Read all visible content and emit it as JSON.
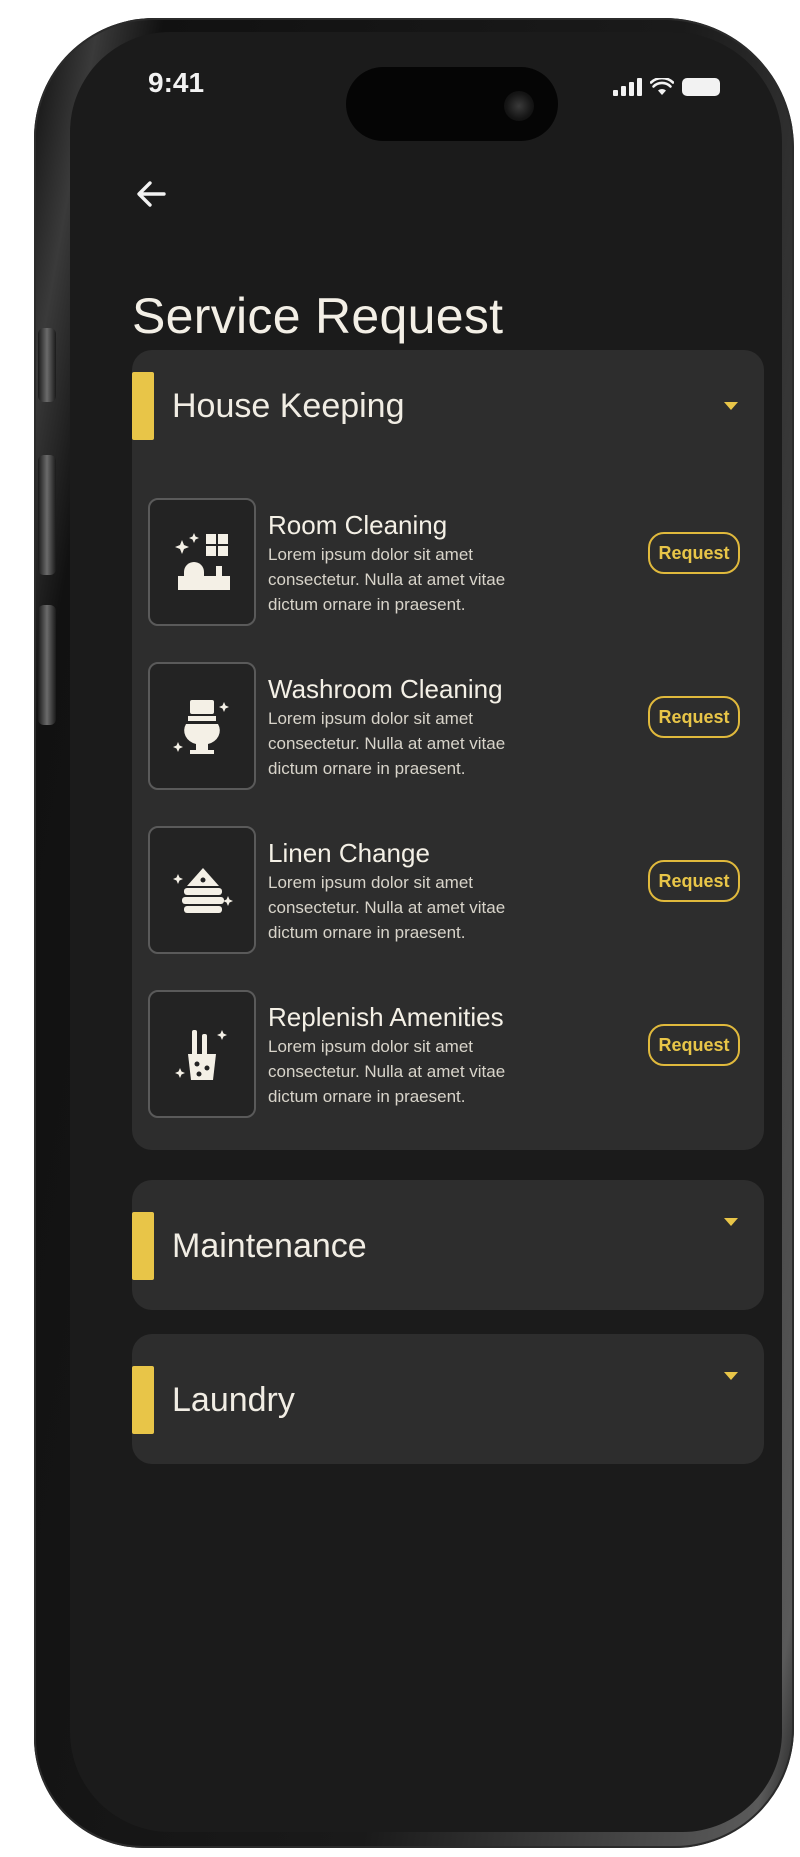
{
  "status_bar": {
    "time": "9:41"
  },
  "header": {
    "back_icon": "arrow-left-icon",
    "title": "Service Request"
  },
  "colors": {
    "accent": "#e8c548",
    "card_bg": "#2d2d2d",
    "screen_bg": "#1b1b1b"
  },
  "sections": [
    {
      "title": "House Keeping",
      "expanded": true,
      "items": [
        {
          "title": "Room Cleaning",
          "description": "Lorem ipsum dolor sit amet consectetur. Nulla at amet vitae dictum ornare in praesent.",
          "icon": "room-cleaning-icon",
          "button": "Request"
        },
        {
          "title": "Washroom Cleaning",
          "description": "Lorem ipsum dolor sit amet consectetur. Nulla at amet vitae dictum ornare in praesent.",
          "icon": "toilet-icon",
          "button": "Request"
        },
        {
          "title": "Linen Change",
          "description": "Lorem ipsum dolor sit amet consectetur. Nulla at amet vitae dictum ornare in praesent.",
          "icon": "linen-icon",
          "button": "Request"
        },
        {
          "title": "Replenish Amenities",
          "description": "Lorem ipsum dolor sit amet consectetur. Nulla at amet vitae dictum ornare in praesent.",
          "icon": "toothbrush-cup-icon",
          "button": "Request"
        }
      ]
    },
    {
      "title": "Maintenance",
      "expanded": false
    },
    {
      "title": "Laundry",
      "expanded": false
    }
  ]
}
